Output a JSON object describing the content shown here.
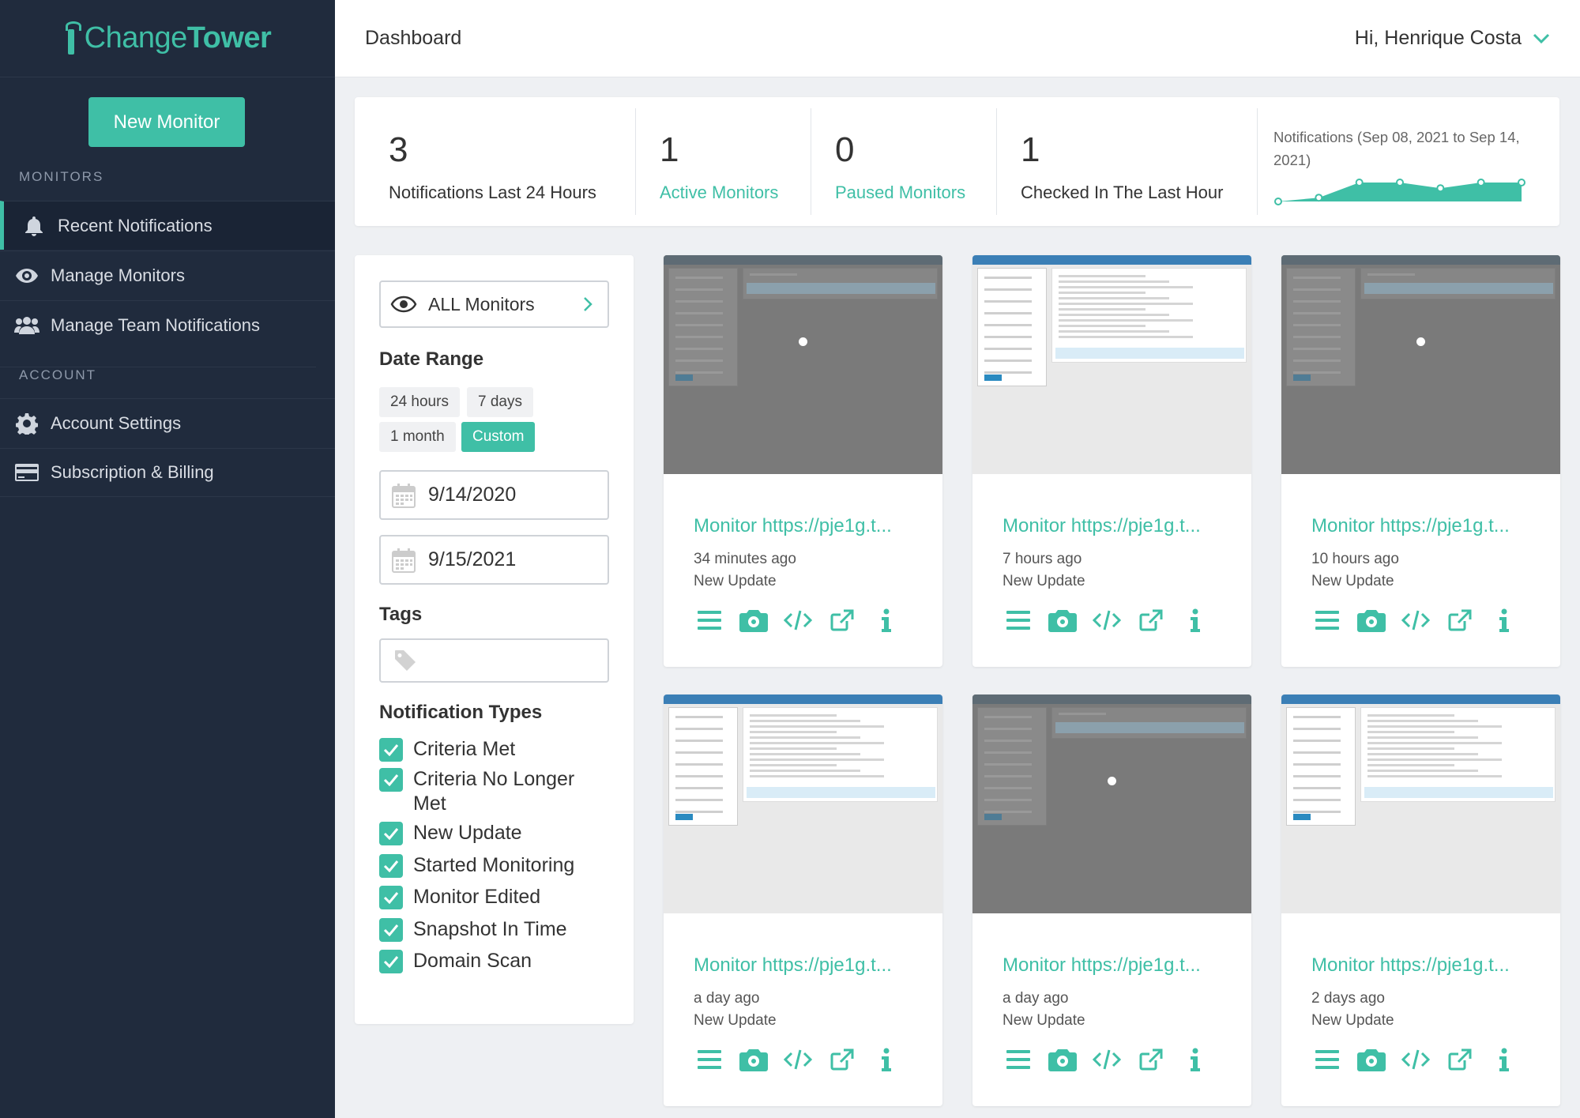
{
  "brand": {
    "part1": "Change",
    "part2": "Tower"
  },
  "sidebar": {
    "new_monitor_label": "New Monitor",
    "monitors_section": "MONITORS",
    "account_section": "ACCOUNT",
    "items": [
      {
        "label": "Recent Notifications",
        "icon": "bell-icon"
      },
      {
        "label": "Manage Monitors",
        "icon": "eye-icon"
      },
      {
        "label": "Manage Team Notifications",
        "icon": "users-icon"
      },
      {
        "label": "Account Settings",
        "icon": "gear-icon"
      },
      {
        "label": "Subscription & Billing",
        "icon": "credit-card-icon"
      }
    ]
  },
  "header": {
    "title": "Dashboard",
    "greeting": "Hi, Henrique Costa"
  },
  "stats": [
    {
      "value": "3",
      "label": "Notifications Last 24 Hours"
    },
    {
      "value": "1",
      "label": "Active Monitors"
    },
    {
      "value": "0",
      "label": "Paused Monitors"
    },
    {
      "value": "1",
      "label": "Checked In The Last Hour"
    }
  ],
  "sparkline": {
    "label": "Notifications (Sep 08, 2021 to Sep 14, 2021)",
    "values": [
      0,
      0.2,
      1,
      1,
      0.7,
      1,
      1
    ]
  },
  "filters": {
    "all_monitors": "ALL Monitors",
    "date_range_heading": "Date Range",
    "ranges": [
      "24 hours",
      "7 days",
      "1 month",
      "Custom"
    ],
    "active_range": "Custom",
    "start_date": "9/14/2020",
    "end_date": "9/15/2021",
    "tags_heading": "Tags",
    "types_heading": "Notification Types",
    "types": [
      "Criteria Met",
      "Criteria No Longer Met",
      "New Update",
      "Started Monitoring",
      "Monitor Edited",
      "Snapshot In Time",
      "Domain Scan"
    ]
  },
  "cards": [
    {
      "title": "Monitor https://pje1g.t...",
      "time": "34 minutes ago",
      "type": "New Update",
      "theme": "dark"
    },
    {
      "title": "Monitor https://pje1g.t...",
      "time": "7 hours ago",
      "type": "New Update",
      "theme": "light"
    },
    {
      "title": "Monitor https://pje1g.t...",
      "time": "10 hours ago",
      "type": "New Update",
      "theme": "dark"
    },
    {
      "title": "Monitor https://pje1g.t...",
      "time": "a day ago",
      "type": "New Update",
      "theme": "light"
    },
    {
      "title": "Monitor https://pje1g.t...",
      "time": "a day ago",
      "type": "New Update",
      "theme": "dark"
    },
    {
      "title": "Monitor https://pje1g.t...",
      "time": "2 days ago",
      "type": "New Update",
      "theme": "light"
    }
  ],
  "colors": {
    "accent": "#3fbfa6",
    "sidebar": "#202b3d"
  }
}
